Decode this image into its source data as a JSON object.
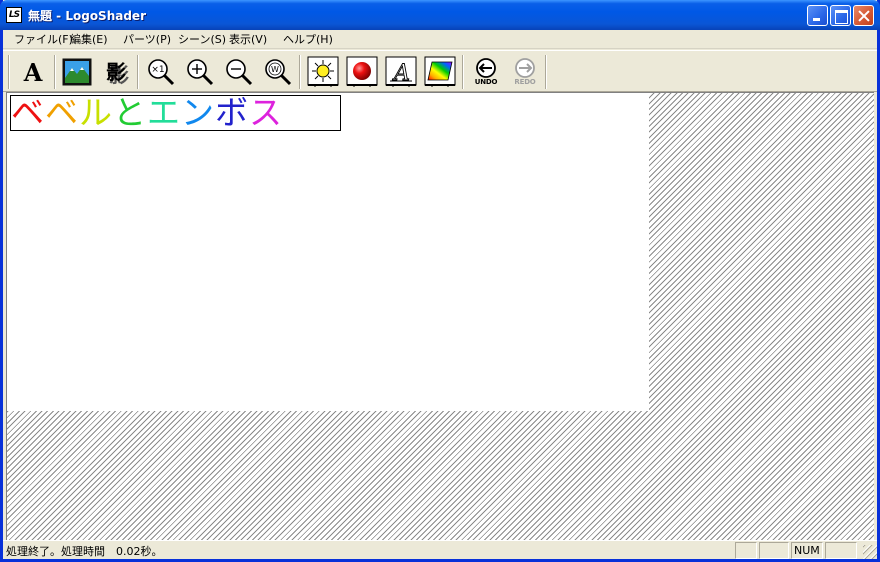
{
  "window": {
    "icon_text": "LS",
    "title": "無題 - LogoShader"
  },
  "menu": [
    {
      "label": "ファイル(F)"
    },
    {
      "label": "編集(E)"
    },
    {
      "label": "パーツ(P)"
    },
    {
      "label": "シーン(S)"
    },
    {
      "label": "表示(V)"
    },
    {
      "label": "ヘルプ(H)"
    }
  ],
  "toolbar": {
    "text_button": "A",
    "zoom_1x_glyph": "×1",
    "zoom_fit_glyph": "W",
    "undo_label": "UNDO",
    "redo_label": "REDO"
  },
  "canvas": {
    "logo_chars": [
      {
        "char": "ベ",
        "color": "#ee1111"
      },
      {
        "char": "ベ",
        "color": "#f0a000"
      },
      {
        "char": "ル",
        "color": "#c8e000"
      },
      {
        "char": "と",
        "color": "#22cc33"
      },
      {
        "char": "エ",
        "color": "#22dd99"
      },
      {
        "char": "ン",
        "color": "#1188ee"
      },
      {
        "char": "ボ",
        "color": "#2222cc"
      },
      {
        "char": "ス",
        "color": "#dd22dd"
      }
    ]
  },
  "statusbar": {
    "message": "処理終了。処理時間　0.02秒。",
    "num_indicator": "NUM"
  },
  "colors": {
    "title_bar": "#0058e6",
    "chrome": "#ece9d8"
  }
}
